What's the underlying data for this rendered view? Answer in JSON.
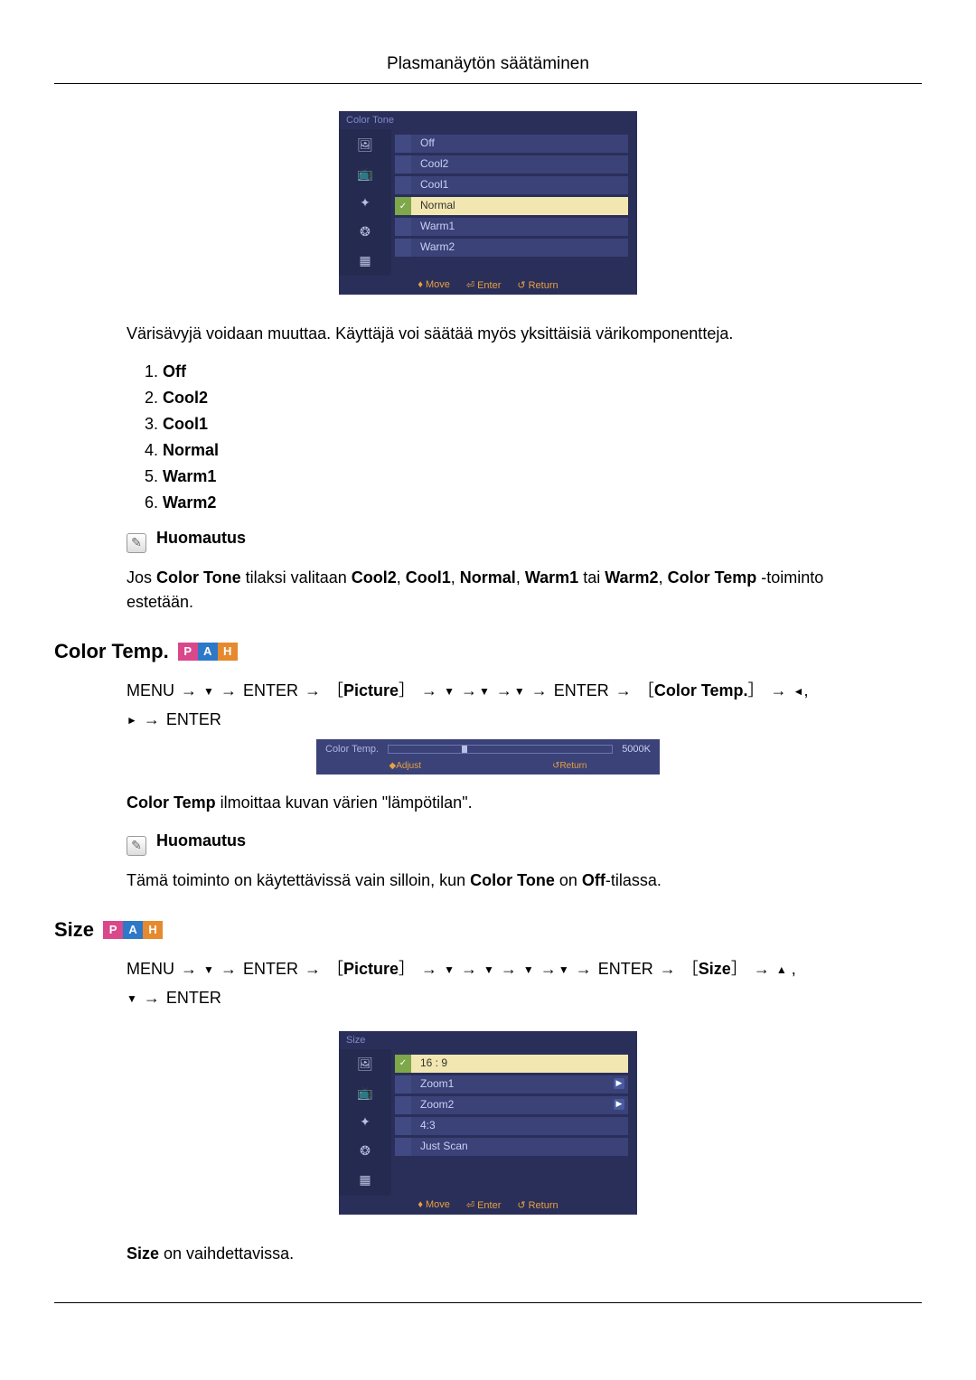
{
  "header": {
    "title": "Plasmanäytön säätäminen"
  },
  "osd_colortone": {
    "title": "Color Tone",
    "options": [
      "Off",
      "Cool2",
      "Cool1",
      "Normal",
      "Warm1",
      "Warm2"
    ],
    "selected_index": 3,
    "footer": {
      "move": "Move",
      "enter": "Enter",
      "return": "Return"
    }
  },
  "intro_para": "Värisävyjä voidaan muuttaa. Käyttäjä voi säätää myös yksittäisiä värikomponentteja.",
  "option_list": [
    "Off",
    "Cool2",
    "Cool1",
    "Normal",
    "Warm1",
    "Warm2"
  ],
  "note1": {
    "label": "Huomautus",
    "prefix": "Jos ",
    "bold1": "Color Tone",
    "mid1": " tilaksi valitaan ",
    "bold2": "Cool2",
    "c": ", ",
    "bold3": "Cool1",
    "bold4": "Normal",
    "bold5": "Warm1",
    "or": " tai ",
    "bold6": "Warm2",
    "mid2": ", ",
    "bold7": "Color Temp",
    "suffix": " -toiminto estetään."
  },
  "section_colortemp": {
    "title": "Color Temp."
  },
  "nav_colortemp": {
    "menu": "MENU",
    "enter": "ENTER",
    "picture": "Picture",
    "colortemp": "Color Temp."
  },
  "osd_colortemp_bar": {
    "label": "Color Temp.",
    "value": "5000K",
    "footer": {
      "adjust": "Adjust",
      "return": "Return"
    }
  },
  "colortemp_desc": {
    "bold": "Color Temp",
    "text": " ilmoittaa kuvan värien \"lämpötilan\"."
  },
  "note2": {
    "label": "Huomautus",
    "prefix": "Tämä toiminto on käytettävissä vain silloin, kun ",
    "bold1": "Color Tone",
    "mid": " on ",
    "bold2": "Off",
    "suffix": "-tilassa."
  },
  "section_size": {
    "title": "Size"
  },
  "nav_size": {
    "menu": "MENU",
    "enter": "ENTER",
    "picture": "Picture",
    "size": "Size"
  },
  "osd_size": {
    "title": "Size",
    "options": [
      "16 : 9",
      "Zoom1",
      "Zoom2",
      "4:3",
      "Just Scan"
    ],
    "selected_index": 0,
    "arrow_indices": [
      1,
      2
    ],
    "footer": {
      "move": "Move",
      "enter": "Enter",
      "return": "Return"
    }
  },
  "size_desc": {
    "bold": "Size",
    "text": " on vaihdettavissa."
  },
  "icons": {
    "picture": "🖼",
    "monitor": "📺",
    "setting1": "✦",
    "setting2": "❂",
    "multi": "▦",
    "note": "✎",
    "updown": "♦",
    "enter": "⏎",
    "return": "↺",
    "leftright": "◆"
  },
  "badges": {
    "p": "P",
    "a": "A",
    "h": "H"
  }
}
